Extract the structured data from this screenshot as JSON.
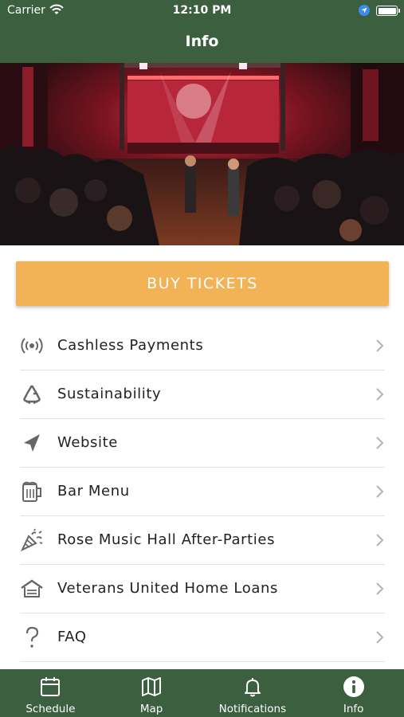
{
  "status_bar": {
    "carrier": "Carrier",
    "time": "12:10 PM"
  },
  "header": {
    "title": "Info"
  },
  "buy_button": {
    "label": "BUY TICKETS",
    "color": "#f2b256"
  },
  "colors": {
    "brand_green": "#3b5f3f"
  },
  "menu": {
    "items": [
      {
        "label": "Cashless Payments",
        "icon": "broadcast-icon"
      },
      {
        "label": "Sustainability",
        "icon": "recycle-icon"
      },
      {
        "label": "Website",
        "icon": "navigation-arrow-icon"
      },
      {
        "label": "Bar Menu",
        "icon": "beer-mug-icon"
      },
      {
        "label": "Rose Music Hall After-Parties",
        "icon": "party-popper-icon"
      },
      {
        "label": "Veterans United Home Loans",
        "icon": "house-icon"
      },
      {
        "label": "FAQ",
        "icon": "question-mark-icon"
      }
    ]
  },
  "tabbar": {
    "tabs": [
      {
        "label": "Schedule",
        "icon": "calendar-icon"
      },
      {
        "label": "Map",
        "icon": "map-icon"
      },
      {
        "label": "Notifications",
        "icon": "bell-icon"
      },
      {
        "label": "Info",
        "icon": "info-icon",
        "selected": true
      }
    ]
  }
}
